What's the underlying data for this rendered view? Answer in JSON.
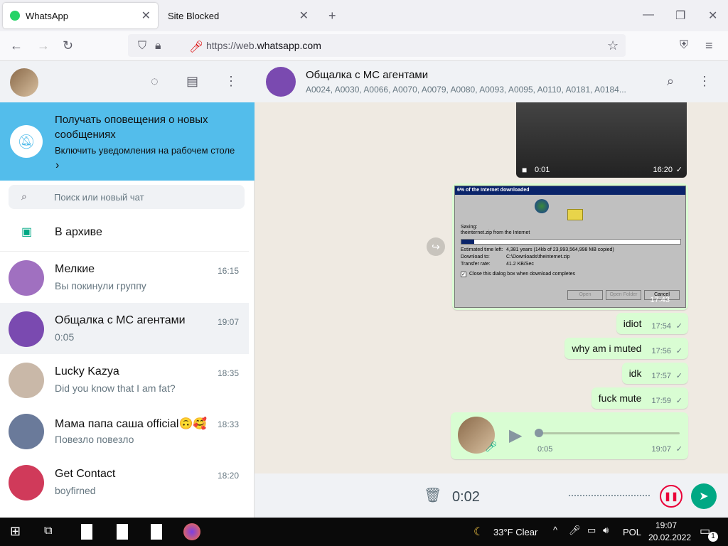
{
  "browser": {
    "tabs": [
      {
        "label": "WhatsApp"
      },
      {
        "label": "Site Blocked"
      }
    ],
    "url_prefix": "https://web.",
    "url_domain": "whatsapp.com"
  },
  "left": {
    "notification": {
      "title": "Получать оповещения о новых сообщениях",
      "subtitle": "Включить уведомления на рабочем столе"
    },
    "search_placeholder": "Поиск или новый чат",
    "archive_label": "В архиве",
    "chats": [
      {
        "name": "Мелкие",
        "last": "Вы покинули группу",
        "time": "16:15"
      },
      {
        "name": "Общалка с МС агентами",
        "last": "0:05",
        "time": "19:07"
      },
      {
        "name": "Lucky Kazya",
        "last": "Did you know that I am fat?",
        "time": "18:35"
      },
      {
        "name": "Мама папа саша official🙃🥰",
        "last": "Повезло повезло",
        "time": "18:33"
      },
      {
        "name": "Get Contact",
        "last": "boyfirned",
        "time": "18:20"
      }
    ]
  },
  "chat": {
    "title": "Общалка с МС агентами",
    "members": "A0024, A0030, A0066, A0070, A0079, A0080, A0093, A0095, A0110, A0181, A0184...",
    "video": {
      "duration": "0:01",
      "time": "16:20"
    },
    "image_msg": {
      "window_title": "6% of the Internet downloaded",
      "saving": "Saving:",
      "file": "theinternet.zip from the Internet",
      "est_label": "Estimated time left:",
      "est_value": "4,381 years (14kb of 23,993,564,998 MB copied)",
      "dl_label": "Download to:",
      "dl_value": "C:\\Downloads\\theinternet.zip",
      "rate_label": "Transfer rate:",
      "rate_value": "41.2 KB/Sec",
      "checkbox": "Close this dialog box when download completes",
      "btn_open": "Open",
      "btn_folder": "Open Folder",
      "btn_cancel": "Cancel",
      "time": "17:43",
      "progress": 0.06
    },
    "messages": [
      {
        "text": "idiot",
        "time": "17:54"
      },
      {
        "text": "why am i muted",
        "time": "17:56"
      },
      {
        "text": "idk",
        "time": "17:57"
      },
      {
        "text": "fuck mute",
        "time": "17:59"
      }
    ],
    "voice": {
      "duration": "0:05",
      "time": "19:07"
    },
    "recording_time": "0:02"
  },
  "taskbar": {
    "weather": "33°F  Clear",
    "lang": "POL",
    "time": "19:07",
    "date": "20.02.2022",
    "notif_count": "1"
  }
}
